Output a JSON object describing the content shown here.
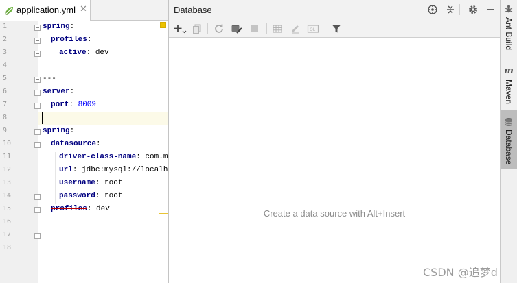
{
  "editor": {
    "tab": {
      "filename": "application.yml",
      "close": "✕",
      "icon": "yaml-spring-leaf-icon"
    },
    "lines": [
      {
        "num": "1",
        "key": "spring",
        "value": "",
        "indent": 0
      },
      {
        "num": "2",
        "key": "profiles",
        "value": "",
        "indent": 1
      },
      {
        "num": "3",
        "key": "active",
        "value": "dev",
        "indent": 2
      },
      {
        "num": "4",
        "key": "",
        "value": "",
        "indent": 0
      },
      {
        "num": "5",
        "key": "",
        "value": "---",
        "indent": 0
      },
      {
        "num": "6",
        "key": "server",
        "value": "",
        "indent": 0
      },
      {
        "num": "7",
        "key": "port",
        "value": "8009",
        "indent": 1
      },
      {
        "num": "8",
        "key": "",
        "value": "",
        "indent": 0
      },
      {
        "num": "9",
        "key": "spring",
        "value": "",
        "indent": 0
      },
      {
        "num": "10",
        "key": "datasource",
        "value": "",
        "indent": 1
      },
      {
        "num": "11",
        "key": "driver-class-name",
        "value": "com.mysq",
        "indent": 2
      },
      {
        "num": "12",
        "key": "url",
        "value": "jdbc:mysql://localhost",
        "indent": 2
      },
      {
        "num": "13",
        "key": "username",
        "value": "root",
        "indent": 2
      },
      {
        "num": "14",
        "key": "password",
        "value": "root",
        "indent": 2
      },
      {
        "num": "15",
        "key": "profiles",
        "value": "dev",
        "indent": 1
      },
      {
        "num": "16",
        "key": "",
        "value": "",
        "indent": 0
      },
      {
        "num": "17",
        "key": "",
        "value": "",
        "indent": 0
      },
      {
        "num": "18",
        "key": "",
        "value": "",
        "indent": 0
      }
    ]
  },
  "database": {
    "title": "Database",
    "header_icons": [
      "target-icon",
      "collapse-icon",
      "gear-icon",
      "minimize-icon"
    ],
    "toolbar_icons": [
      "add-icon",
      "duplicate-icon",
      "refresh-icon",
      "schema-sync-icon",
      "stop-icon",
      "table-icon",
      "edit-icon",
      "console-icon",
      "filter-icon"
    ],
    "empty_text": "Create a data source with Alt+Insert"
  },
  "sidebar": {
    "tabs": [
      {
        "label": "Ant Build",
        "icon": "ant-icon",
        "active": false
      },
      {
        "label": "Maven",
        "icon": "maven-icon",
        "icon_text": "m",
        "active": false
      },
      {
        "label": "Database",
        "icon": "database-icon",
        "active": true
      }
    ]
  },
  "watermark": "CSDN @追梦d"
}
